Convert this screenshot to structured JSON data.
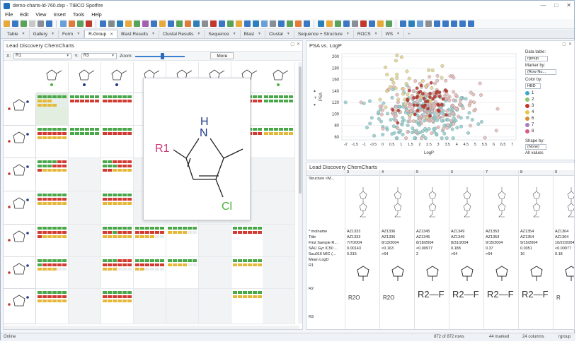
{
  "window": {
    "title": "demo-charts-ld-760.dxp - TIBCO Spotfire"
  },
  "menu": [
    "File",
    "Edit",
    "View",
    "Insert",
    "Tools",
    "Help"
  ],
  "tabs": [
    {
      "label": "Table"
    },
    {
      "label": "Gallery"
    },
    {
      "label": "Form"
    },
    {
      "label": "R-Group",
      "active": true
    },
    {
      "label": "Blast Results"
    },
    {
      "label": "Clustal Results"
    },
    {
      "label": "Sequence"
    },
    {
      "label": "Blast"
    },
    {
      "label": "Clustal"
    },
    {
      "label": "Sequence + Structure"
    },
    {
      "label": "ROCS"
    },
    {
      "label": "WS"
    }
  ],
  "left_panel": {
    "title": "Lead Discovery ChemCharts",
    "x_label": "X:",
    "x_value": "R1",
    "y_label": "Y:",
    "y_value": "R3",
    "zoom_label": "Zoom:",
    "zoom_level": 0.55,
    "more_button": "More",
    "popup": {
      "r1": "R1",
      "nh": "N",
      "h": "H",
      "cl": "Cl"
    }
  },
  "scatter_panel": {
    "title": "PSA vs. LogP",
    "legend": {
      "data_table_label": "Data table:",
      "data_table_value": "rgroup",
      "marker_by_label": "Marker by:",
      "marker_by_value": "(Row Nu...",
      "color_by_label": "Color by:",
      "color_by_value": "HBD",
      "categories": [
        {
          "label": "1",
          "color": "#3aa7c9"
        },
        {
          "label": "2",
          "color": "#8cc56a"
        },
        {
          "label": "3",
          "color": "#c8342c"
        },
        {
          "label": "4",
          "color": "#e2c64a"
        },
        {
          "label": "6",
          "color": "#d98a3a"
        },
        {
          "label": "7",
          "color": "#a97bc4"
        },
        {
          "label": "8",
          "color": "#d85a8a"
        }
      ],
      "shape_by_label": "Shape by:",
      "shape_by_value": "(None)",
      "all_values": "All values",
      "size_by_label": "Size by:"
    }
  },
  "chart_data": {
    "type": "scatter",
    "title": "PSA vs. LogP",
    "xlabel": "LogP",
    "ylabel": "PSA",
    "xlim": [
      -2.2,
      7.2
    ],
    "ylim": [
      55,
      205
    ],
    "x_ticks": [
      "-2",
      "-1.5",
      "-1",
      "-0.5",
      "0",
      "0.5",
      "1",
      "1.5",
      "2",
      "2.5",
      "3",
      "3.5",
      "4",
      "4.5",
      "5",
      "5.5",
      "6",
      "6.5",
      "7"
    ],
    "y_ticks": [
      "60",
      "80",
      "100",
      "120",
      "140",
      "160",
      "180",
      "200"
    ],
    "series": [
      {
        "name": "1",
        "color": "#8fcfcf",
        "n": 190,
        "cx": 2.2,
        "cy": 95,
        "sx": 1.4,
        "sy": 22
      },
      {
        "name": "2",
        "color": "#e6b9b5",
        "n": 170,
        "cx": 2.6,
        "cy": 115,
        "sx": 1.3,
        "sy": 22
      },
      {
        "name": "4",
        "color": "#e2d48a",
        "n": 40,
        "cx": 1.3,
        "cy": 140,
        "sx": 1.2,
        "sy": 28
      },
      {
        "name": "3",
        "color": "#b83028",
        "n": 45,
        "cx": 2.4,
        "cy": 120,
        "sx": 0.7,
        "sy": 14
      }
    ]
  },
  "table_panel": {
    "title": "Lead Discovery ChemCharts",
    "structure_row": "Structure <M...",
    "col_numbers": [
      "3",
      "4",
      "5",
      "6",
      "7",
      "8",
      "9"
    ],
    "row_labels": [
      "* molname",
      "Title",
      "First Sample R...",
      "SAU Gyr IC50 ...",
      "Sau016 MIC (...",
      "Mean LogD"
    ],
    "r_labels": [
      "R1",
      "R2",
      "R3"
    ],
    "columns": [
      {
        "molname": "AZ1333",
        "title": "AZ1333",
        "date": "7/7/2004",
        "ic50": "0.00143",
        "mic": "0.315"
      },
      {
        "molname": "AZ1336",
        "title": "AZ1336",
        "date": "8/13/2004",
        "ic50": "<0.163",
        "mic": ">64"
      },
      {
        "molname": "AZ1345",
        "title": "AZ1345",
        "date": "8/18/2004",
        "ic50": "<0.00977",
        "mic": "2"
      },
      {
        "molname": "AZ1349",
        "title": "AZ1349",
        "date": "8/31/2004",
        "ic50": "0.188",
        "mic": ">64"
      },
      {
        "molname": "AZ1353",
        "title": "AZ1353",
        "date": "9/15/2004",
        "ic50": "0.37",
        "mic": ">64"
      },
      {
        "molname": "AZ1354",
        "title": "AZ1354",
        "date": "9/15/2004",
        "ic50": "0.0351",
        "mic": "16"
      },
      {
        "molname": "AZ1364",
        "title": "AZ1364",
        "date": "10/22/2004",
        "ic50": "<0.00977",
        "mic": "0.18"
      }
    ],
    "r2_cells": [
      "R2O",
      "R2O",
      "R2—F",
      "R2—F",
      "R2—F",
      "R2—F",
      "R"
    ]
  },
  "status": {
    "left": "Online",
    "rows": "872 of 872 rows",
    "marked": "44 marked",
    "columns": "24 columns",
    "table": "rgroup"
  }
}
